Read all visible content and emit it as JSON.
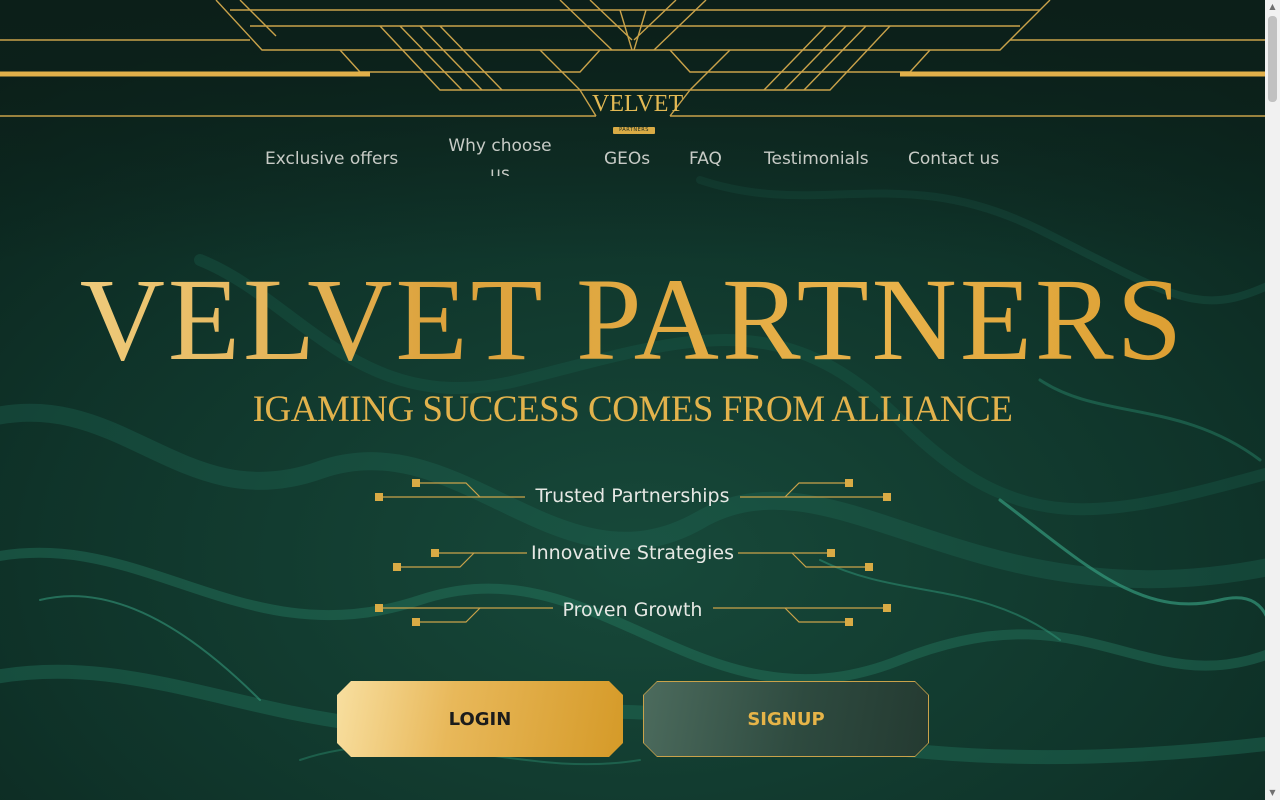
{
  "logo": {
    "main": "VELVET",
    "sub": "PARTNERS"
  },
  "nav": {
    "items": [
      {
        "label": "Exclusive offers"
      },
      {
        "label": "Why choose us"
      },
      {
        "label": "GEOs"
      },
      {
        "label": "FAQ"
      },
      {
        "label": "Testimonials"
      },
      {
        "label": "Contact us"
      }
    ]
  },
  "hero": {
    "title": "VELVET PARTNERS",
    "subtitle": "IGAMING SUCCESS COMES FROM ALLIANCE"
  },
  "features": [
    {
      "label": "Trusted Partnerships"
    },
    {
      "label": "Innovative Strategies"
    },
    {
      "label": "Proven Growth"
    }
  ],
  "buttons": {
    "login": "LOGIN",
    "signup": "SIGNUP"
  },
  "colors": {
    "background": "#0d2a22",
    "gold": "#e1ad45",
    "nav_text": "#c7cbc6",
    "feature_text": "#e6e8e4"
  },
  "icons": {
    "scroll_up": "chevron-up-icon",
    "scroll_down": "chevron-down-icon"
  }
}
